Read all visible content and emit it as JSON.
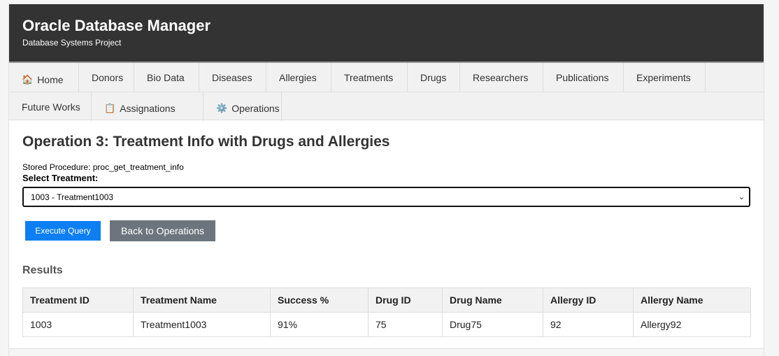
{
  "header": {
    "title": "Oracle Database Manager",
    "subtitle": "Database Systems Project"
  },
  "nav": {
    "row1": [
      {
        "label": "Home",
        "icon": "house-icon"
      },
      {
        "label": "Donors"
      },
      {
        "label": "Bio Data"
      },
      {
        "label": "Diseases"
      },
      {
        "label": "Allergies"
      },
      {
        "label": "Treatments"
      },
      {
        "label": "Drugs"
      },
      {
        "label": "Researchers"
      },
      {
        "label": "Publications"
      },
      {
        "label": "Experiments"
      }
    ],
    "row2": [
      {
        "label": "Future Works"
      },
      {
        "label": "Assignations",
        "icon": "clipboard-icon"
      },
      {
        "label": "Operations",
        "icon": "gear-icon"
      }
    ]
  },
  "main": {
    "title": "Operation 3: Treatment Info with Drugs and Allergies",
    "stored_procedure": "Stored Procedure: proc_get_treatment_info",
    "select_label": "Select Treatment:",
    "selected_value": "1003 - Treatment1003",
    "execute_label": "Execute Query",
    "back_label": "Back to Operations",
    "results_title": "Results"
  },
  "table": {
    "headers": [
      "Treatment ID",
      "Treatment Name",
      "Success %",
      "Drug ID",
      "Drug Name",
      "Allergy ID",
      "Allergy Name"
    ],
    "rows": [
      [
        "1003",
        "Treatment1003",
        "91%",
        "75",
        "Drug75",
        "92",
        "Allergy92"
      ]
    ]
  },
  "colors": {
    "header_bg": "#333333",
    "primary_button": "#0d7ff2",
    "secondary_button": "#6c757d"
  }
}
